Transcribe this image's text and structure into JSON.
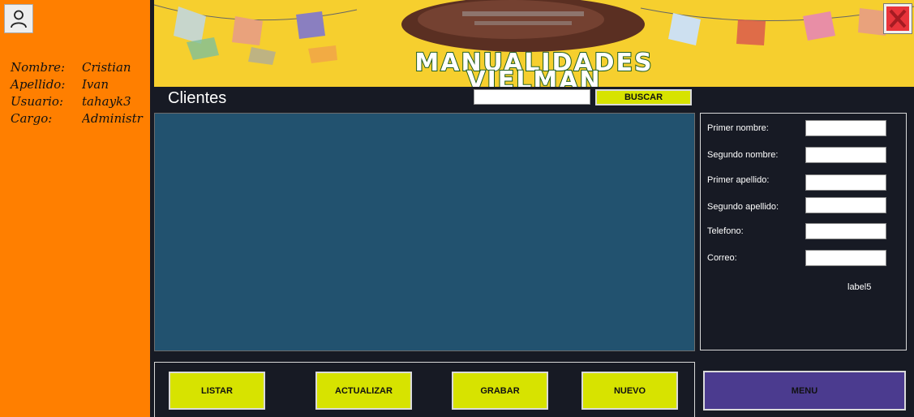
{
  "app": {
    "brand_line1": "MANUALIDADES",
    "brand_line2": "VIELMAN"
  },
  "user": {
    "rows": [
      {
        "label": "Nombre:",
        "value": "Cristian"
      },
      {
        "label": "Apellido:",
        "value": "Ivan"
      },
      {
        "label": "Usuario:",
        "value": "tahayk3"
      },
      {
        "label": "Cargo:",
        "value": "Administr"
      }
    ]
  },
  "section": {
    "title": "Clientes"
  },
  "search": {
    "value": "",
    "button_label": "BUSCAR"
  },
  "form": {
    "fields": [
      {
        "label": "Primer nombre:",
        "value": ""
      },
      {
        "label": "Segundo nombre:",
        "value": ""
      },
      {
        "label": "Primer apellido:",
        "value": ""
      },
      {
        "label": "Segundo apellido:",
        "value": ""
      },
      {
        "label": "Telefono:",
        "value": ""
      },
      {
        "label": "Correo:",
        "value": ""
      }
    ],
    "extra_label": "label5"
  },
  "actions": {
    "listar": "LISTAR",
    "actualizar": "ACTUALIZAR",
    "grabar": "GRABAR",
    "nuevo": "NUEVO",
    "menu": "MENU"
  },
  "icons": {
    "user": "user-icon",
    "close": "close-icon"
  },
  "colors": {
    "sidebar": "#ff7f00",
    "background": "#171a24",
    "grid": "#22526f",
    "action_button": "#d7e300",
    "menu_button": "#4b3b8f",
    "close_icon": "#e8343b",
    "banner": "#f6cf2e"
  }
}
